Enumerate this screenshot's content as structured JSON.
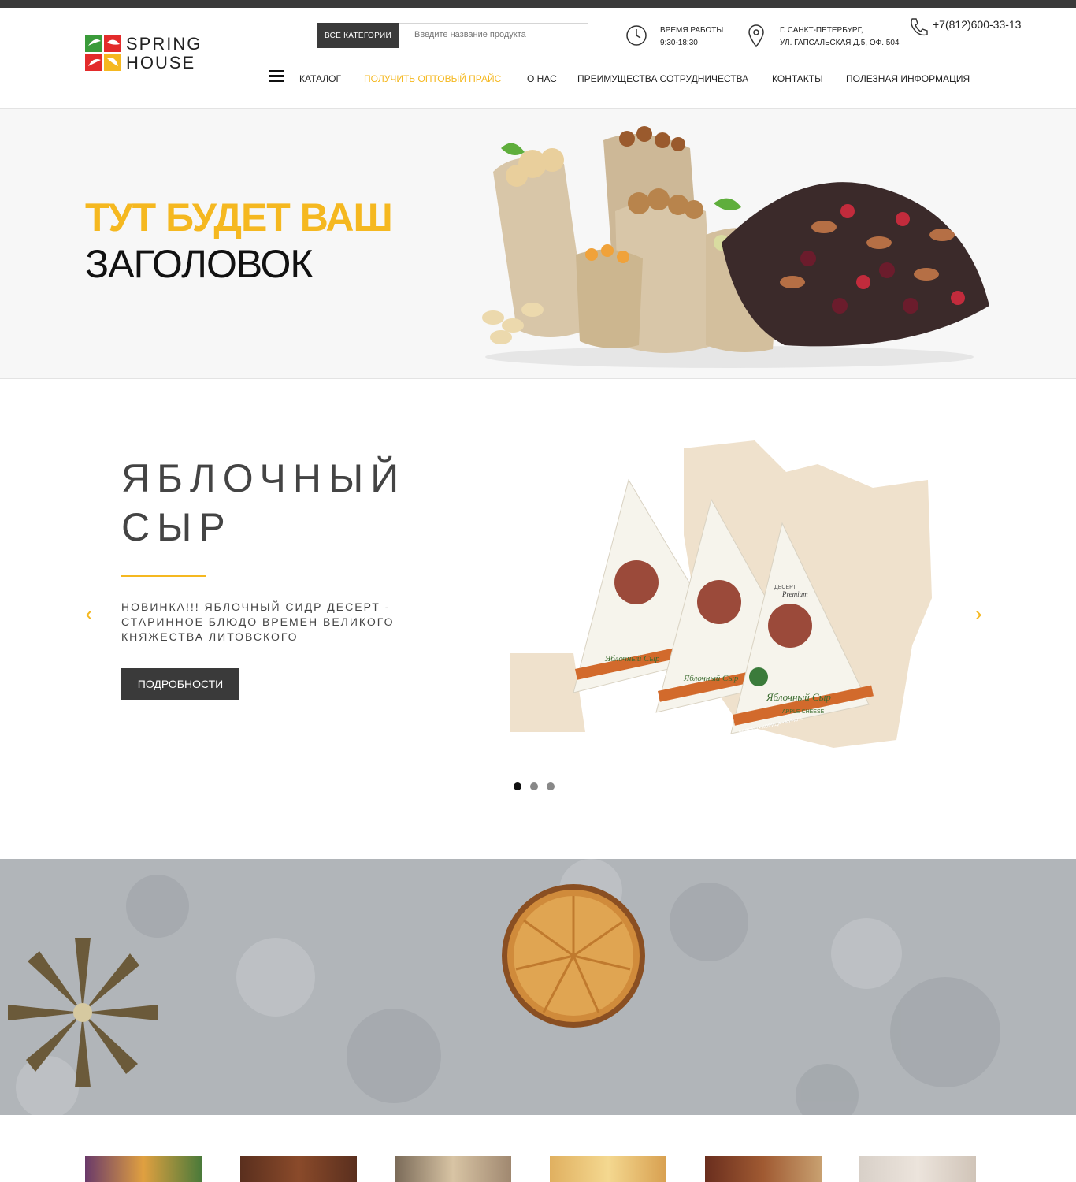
{
  "brand": {
    "line1": "SPRING",
    "line2": "HOUSE"
  },
  "header": {
    "categories_button": "ВСЕ КАТЕГОРИИ",
    "search_placeholder": "Введите название продукта",
    "hours_label": "ВРЕМЯ РАБОТЫ",
    "hours_value": "9:30-18:30",
    "address_line1": "Г. САНКТ-ПЕТЕРБУРГ,",
    "address_line2": "УЛ. ГАПСАЛЬСКАЯ Д.5, ОФ. 504",
    "phone": "+7(812)600-33-13"
  },
  "nav": {
    "items": [
      {
        "label": "КАТАЛОГ"
      },
      {
        "label": "ПОЛУЧИТЬ ОПТОВЫЙ ПРАЙС"
      },
      {
        "label": "О НАС"
      },
      {
        "label": "ПРЕИМУЩЕСТВА СОТРУДНИЧЕСТВА"
      },
      {
        "label": "КОНТАКТЫ"
      },
      {
        "label": "ПОЛЕЗНАЯ ИНФОРМАЦИЯ"
      }
    ]
  },
  "hero": {
    "title_accent": "ТУТ БУДЕТ ВАШ",
    "title_main": "ЗАГОЛОВОК"
  },
  "slider": {
    "title_line1": "ЯБЛОЧНЫЙ",
    "title_line2": "СЫР",
    "description": "НОВИНКА!!! ЯБЛОЧНЫЙ СИДР ДЕСЕРТ - СТАРИННОЕ БЛЮДО ВРЕМЕН ВЕЛИКОГО КНЯЖЕСТВА ЛИТОВСКОГО",
    "button": "ПОДРОБНОСТИ",
    "slide_count": 3,
    "active_slide": 1,
    "packaging": {
      "label_top": "ДЕСЕРТ",
      "label_brand": "Premium",
      "product_name": "Яблочный Сыр",
      "product_name_en": "APPLE CHEESE",
      "ingredients": "ЯБЛОКО • КОРИЦА • КУРАГА"
    }
  },
  "colors": {
    "accent": "#f5b820",
    "dark": "#3a3a3a",
    "logo_red": "#e32b2b",
    "logo_green": "#3a9b3a",
    "logo_yellow": "#f5b820"
  }
}
